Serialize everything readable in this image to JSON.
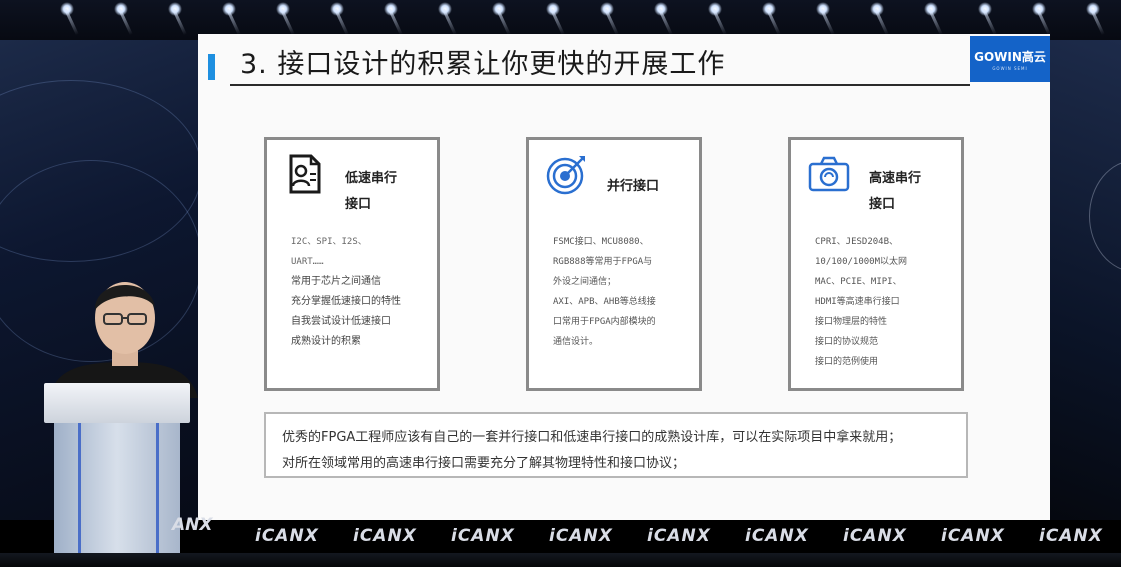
{
  "slide": {
    "title": "3. 接口设计的积累让你更快的开展工作",
    "logo_text": "GOWIN高云",
    "logo_sub": "GOWIN SEMI",
    "cards": [
      {
        "title_line1": "低速串行",
        "title_line2": "接口",
        "icon": "document-person-icon",
        "body_mono": "I2C、SPI、I2S、\nUART……",
        "body": "常用于芯片之间通信\n充分掌握低速接口的特性\n自我尝试设计低速接口\n成熟设计的积累"
      },
      {
        "title_line1": "并行接口",
        "title_line2": "",
        "icon": "target-icon",
        "body_mono": "",
        "body": "FSMC接口、MCU8080、\nRGB888等常用于FPGA与\n外设之间通信；\nAXI、APB、AHB等总线接\n口常用于FPGA内部模块的\n通信设计。"
      },
      {
        "title_line1": "高速串行",
        "title_line2": "接口",
        "icon": "camera-icon",
        "body_mono": "",
        "body": "CPRI、JESD204B、\n10/100/1000M以太网\nMAC、PCIE、MIPI、\nHDMI等高速串行接口\n接口物理层的特性\n接口的协议规范\n接口的范例使用"
      }
    ],
    "note": {
      "line1": "优秀的FPGA工程师应该有自己的一套并行接口和低速串行接口的成熟设计库，可以在实际项目中拿来就用；",
      "line2": "对所在领域常用的高速串行接口需要充分了解其物理特性和接口协议；"
    }
  },
  "stage": {
    "banner_text": "iCANX",
    "podium_tag": "ANX"
  },
  "colors": {
    "accent": "#1e8fe0",
    "logo_bg": "#1463c8",
    "icon_blue": "#2a6fd0"
  }
}
